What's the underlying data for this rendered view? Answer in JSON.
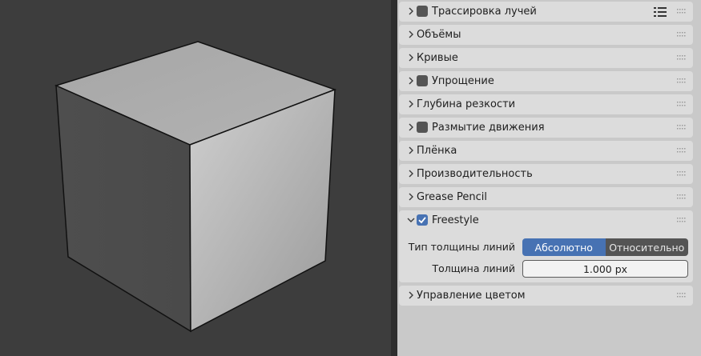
{
  "properties_panels": [
    {
      "label": "Трассировка лучей",
      "has_checkbox": true,
      "checked": false,
      "expanded": false,
      "has_list_icon": true
    },
    {
      "label": "Объёмы",
      "has_checkbox": false,
      "expanded": false
    },
    {
      "label": "Кривые",
      "has_checkbox": false,
      "expanded": false
    },
    {
      "label": "Упрощение",
      "has_checkbox": true,
      "checked": false,
      "expanded": false
    },
    {
      "label": "Глубина резкости",
      "has_checkbox": false,
      "expanded": false
    },
    {
      "label": "Размытие движения",
      "has_checkbox": true,
      "checked": false,
      "expanded": false
    },
    {
      "label": "Плёнка",
      "has_checkbox": false,
      "expanded": false
    },
    {
      "label": "Производительность",
      "has_checkbox": false,
      "expanded": false
    },
    {
      "label": "Grease Pencil",
      "has_checkbox": false,
      "expanded": false
    },
    {
      "label": "Freestyle",
      "has_checkbox": true,
      "checked": true,
      "expanded": true
    },
    {
      "label": "Управление цветом",
      "has_checkbox": false,
      "expanded": false
    }
  ],
  "freestyle": {
    "line_thickness_mode_label": "Тип толщины линий",
    "mode_options": [
      "Абсолютно",
      "Относительно"
    ],
    "selected_mode": "Абсолютно",
    "line_thickness_label": "Толщина линий",
    "line_thickness_value": "1.000 px"
  },
  "colors": {
    "accent": "#4772b3",
    "panel_bg": "#dcdcdc",
    "editor_bg": "#c9c9c9",
    "viewport_bg": "#3d3d3d"
  },
  "icons": {
    "collapsed": "chevron-right-icon",
    "expanded": "chevron-down-icon",
    "drag": "drag-grip-icon",
    "presets": "preset-list-icon",
    "checked": "checkmark-icon"
  }
}
